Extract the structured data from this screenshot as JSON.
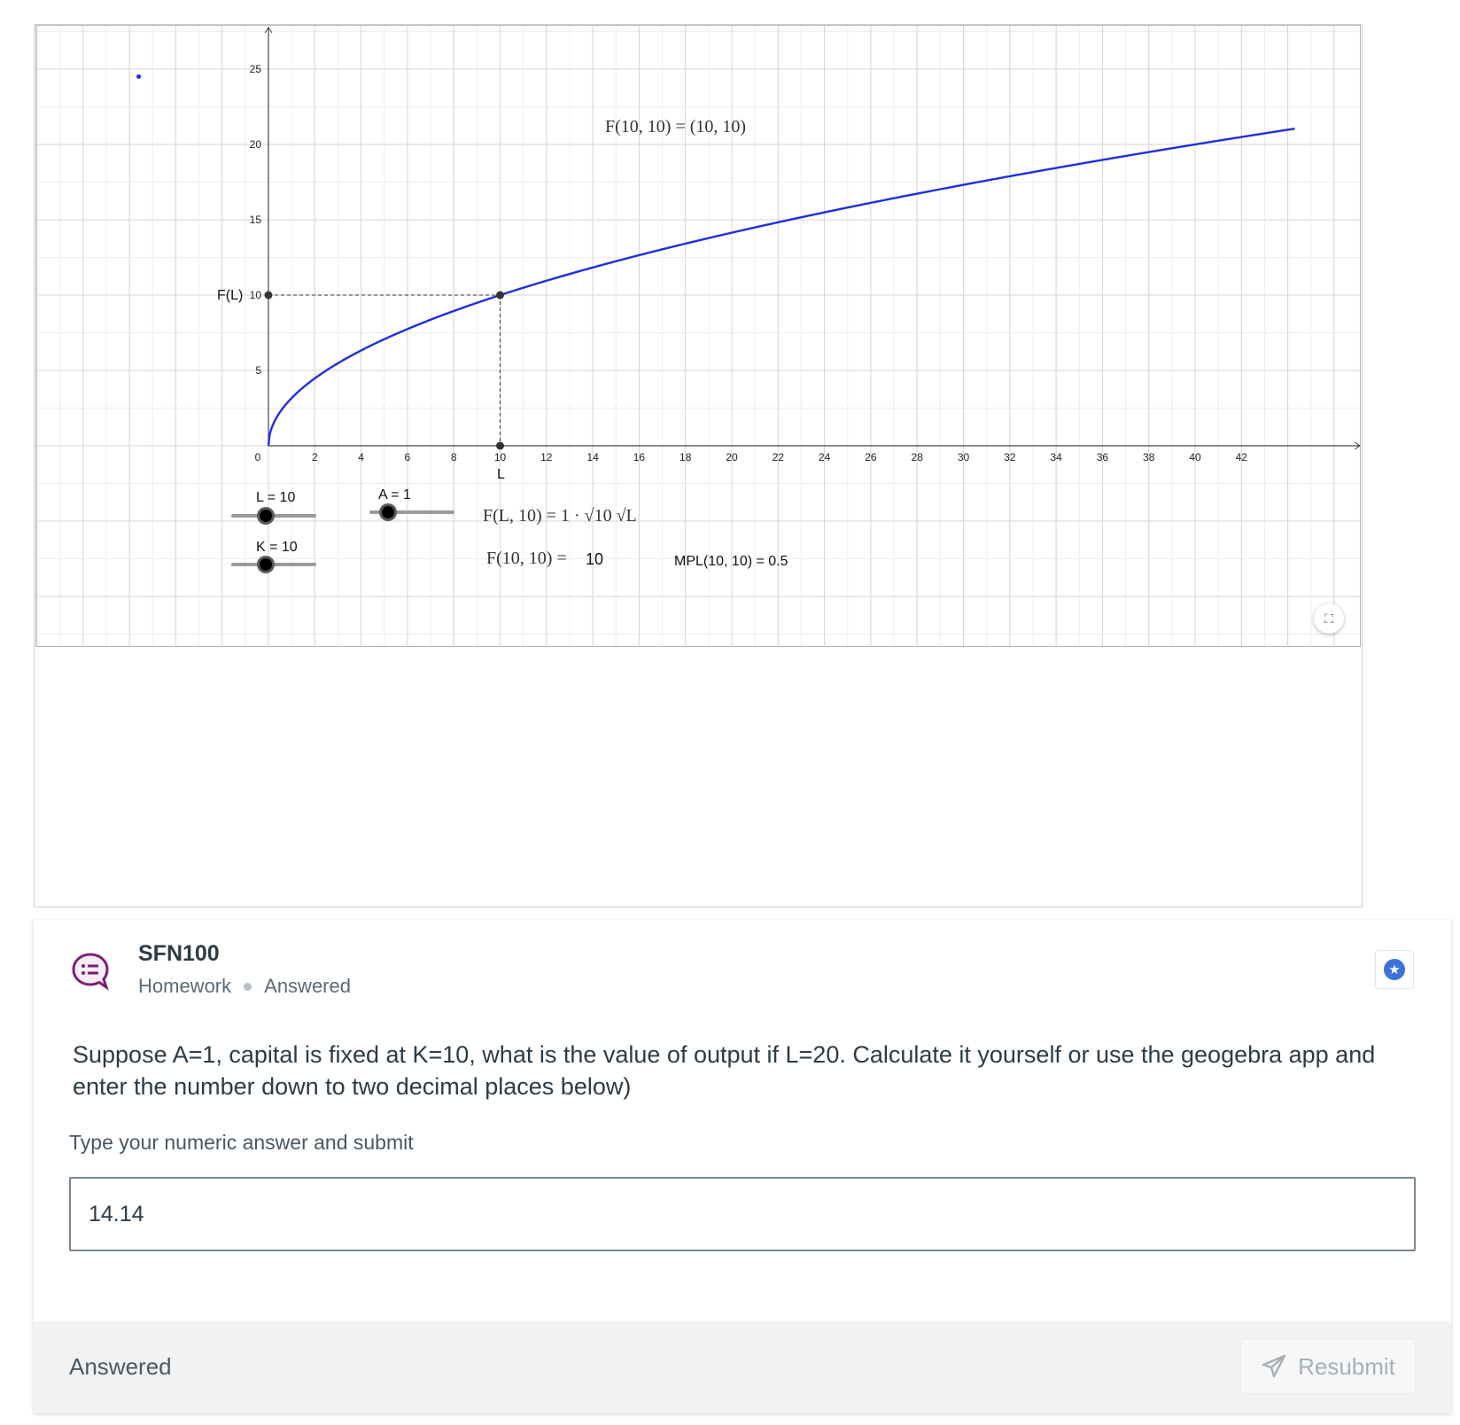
{
  "applet": {
    "title_point_label": "F(10,  10) = (10, 10)",
    "y_axis_label": "F(L)",
    "x_axis_label": "L",
    "slider_L": {
      "label": "L = 10",
      "value": 10
    },
    "slider_K": {
      "label": "K = 10",
      "value": 10
    },
    "slider_A": {
      "label": "A = 1",
      "value": 1
    },
    "formula": "F(L,  10) =  1  · √10 √L",
    "value_label": "F(10, 10) =",
    "value_number": "10",
    "mpl_label": "MPL(10, 10) = 0.5",
    "fullscreen_icon": "expand-icon"
  },
  "chart_data": {
    "type": "line",
    "x_ticks": [
      0,
      2,
      4,
      6,
      8,
      10,
      12,
      14,
      16,
      18,
      20,
      22,
      24,
      26,
      28,
      30,
      32,
      34,
      36,
      38,
      40,
      42
    ],
    "y_ticks": [
      5,
      10,
      15,
      20,
      25
    ],
    "xlim": [
      0,
      44.3
    ],
    "ylim": [
      0,
      28
    ],
    "grid": true,
    "series": [
      {
        "function": "sqrt(10*L)",
        "color": "#1f2ee0"
      }
    ],
    "highlight_point": {
      "x": 10,
      "y": 10
    },
    "stray_point": {
      "x": -5.6,
      "y": 24.5
    }
  },
  "card": {
    "title": "SFN100",
    "meta_type": "Homework",
    "meta_status": "Answered",
    "icon": "question-chat-icon",
    "star_icon": "star-icon",
    "question": "Suppose A=1, capital is fixed at K=10, what is the value of output if L=20. Calculate it yourself or use the geogebra app and enter the number down to two decimal places below)",
    "answer_label": "Type your numeric answer and submit",
    "answer_value": "14.14",
    "footer_status": "Answered",
    "resubmit_label": "Resubmit"
  }
}
